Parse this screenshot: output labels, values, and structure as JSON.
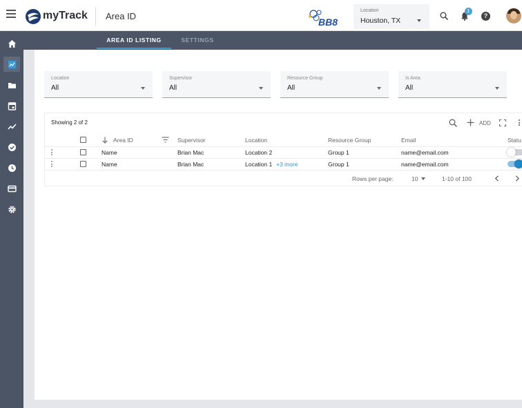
{
  "app": {
    "name": "myTrack",
    "page_title": "Area ID",
    "brand_logo_text": "BB8"
  },
  "header": {
    "location_label": "Location",
    "location_value": "Houston, TX",
    "notification_count": "1",
    "help_icon": "?"
  },
  "sidebar": {
    "items": [
      {
        "name": "home-icon"
      },
      {
        "name": "dashboard-icon",
        "active": true
      },
      {
        "name": "folder-icon"
      },
      {
        "name": "calendar-icon"
      },
      {
        "name": "trend-icon"
      },
      {
        "name": "check-circle-icon"
      },
      {
        "name": "clock-icon"
      },
      {
        "name": "card-icon"
      },
      {
        "name": "gear-icon"
      }
    ]
  },
  "tabs": [
    {
      "label": "AREA ID LISTING",
      "active": true
    },
    {
      "label": "SETTINGS",
      "active": false
    }
  ],
  "filters": [
    {
      "label": "Location",
      "value": "All"
    },
    {
      "label": "Supervisor",
      "value": "All"
    },
    {
      "label": "Resource Group",
      "value": "All"
    },
    {
      "label": "Is Area",
      "value": "All"
    }
  ],
  "table": {
    "showing": "Showing 2 of 2",
    "add_label": "ADD",
    "columns": [
      "Area ID",
      "Supervisor",
      "Location",
      "Resource Group",
      "Email",
      "Status"
    ],
    "status_header_visible": "Statu",
    "rows": [
      {
        "area_id": "Name",
        "supervisor": "Brian Mac",
        "location": "Location 2",
        "more": "",
        "resource_group": "Group 1",
        "email": "name@email.com",
        "status_on": false
      },
      {
        "area_id": "Name",
        "supervisor": "Brian Mac",
        "location": "Location 1",
        "more": "+3 more",
        "resource_group": "Group 1",
        "email": "name@email.com",
        "status_on": true
      }
    ],
    "footer": {
      "rows_per_page_label": "Rows per page:",
      "rows_per_page_value": "10",
      "range": "1-10 of 100"
    }
  },
  "colors": {
    "sidebar_bg": "#4b5565",
    "accent": "#3a9bd5",
    "toggle_on": "#1e88c7"
  }
}
